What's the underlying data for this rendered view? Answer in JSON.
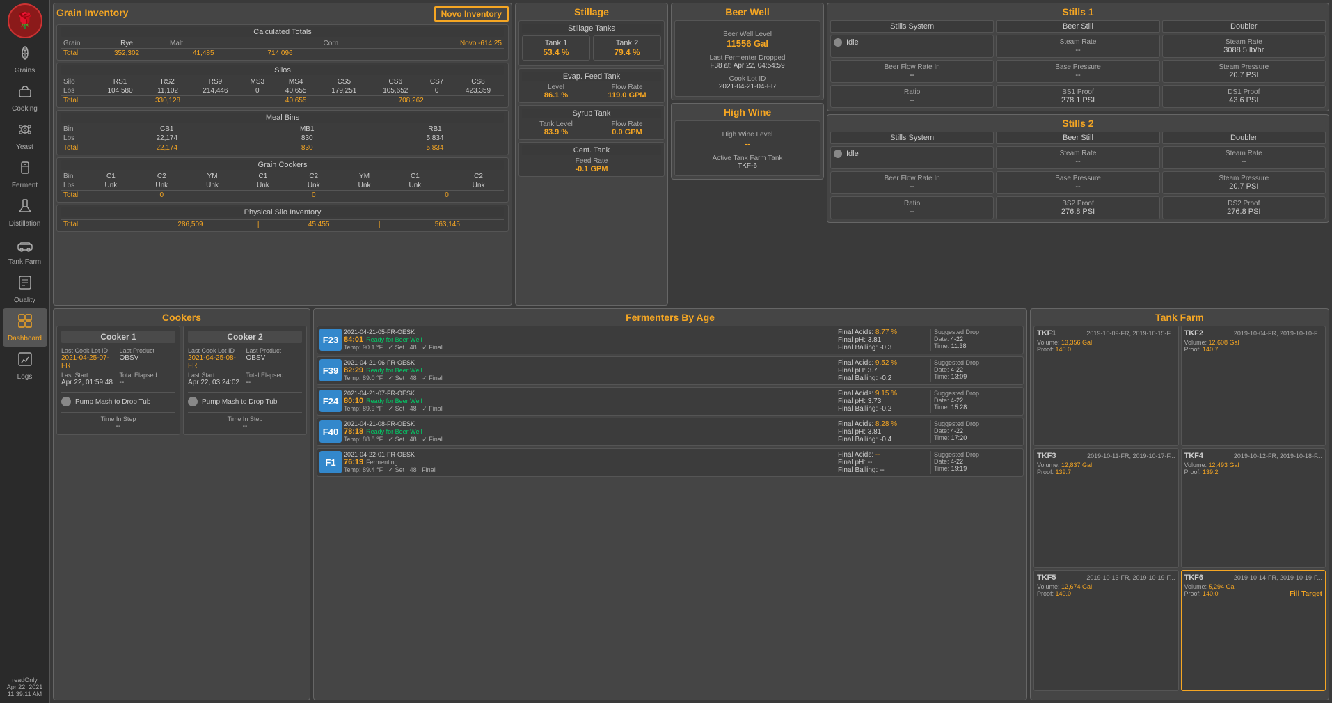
{
  "sidebar": {
    "logo_symbol": "🌹",
    "items": [
      {
        "label": "Grains",
        "icon": "🌾",
        "active": false
      },
      {
        "label": "Cooking",
        "icon": "🍲",
        "active": false
      },
      {
        "label": "Yeast",
        "icon": "⚙️",
        "active": false
      },
      {
        "label": "Ferment",
        "icon": "🧪",
        "active": false
      },
      {
        "label": "Distillation",
        "icon": "🧴",
        "active": false
      },
      {
        "label": "Tank Farm",
        "icon": "🚚",
        "active": false
      },
      {
        "label": "Quality",
        "icon": "📋",
        "active": false
      },
      {
        "label": "Dashboard",
        "icon": "📊",
        "active": true
      },
      {
        "label": "Logs",
        "icon": "📈",
        "active": false
      }
    ],
    "status": {
      "user": "readOnly",
      "date": "Apr 22, 2021",
      "time": "11:39:11 AM"
    }
  },
  "grain_inventory": {
    "title": "Grain Inventory",
    "novo_btn": "Novo Inventory",
    "novo_value": "-614.25",
    "calculated_totals": {
      "title": "Calculated Totals",
      "cols": [
        "Grain",
        "Novo",
        "-614.25"
      ],
      "row1_labels": [
        "Grain",
        "Malt",
        "Corn"
      ],
      "row1_vals": [
        "Rye",
        "",
        ""
      ],
      "total_label": "Total",
      "totals": [
        "352,302",
        "41,485",
        "714,096"
      ]
    },
    "silos": {
      "title": "Silos",
      "headers": [
        "Silo",
        "RS1",
        "RS2",
        "RS9",
        "MS3",
        "MS4",
        "CS5",
        "CS6",
        "CS7",
        "CS8"
      ],
      "lbs_row": [
        "Lbs",
        "104,580",
        "11,102",
        "214,446",
        "0",
        "40,655",
        "179,251",
        "105,652",
        "0",
        "423,359"
      ],
      "total_row": [
        "Total",
        "330,128",
        "",
        "",
        "",
        "40,655",
        "",
        "",
        "",
        "708,262"
      ]
    },
    "meal_bins": {
      "title": "Meal Bins",
      "headers": [
        "Bin",
        "CB1",
        "",
        "MB1",
        "",
        "RB1"
      ],
      "lbs_row": [
        "Lbs",
        "22,174",
        "",
        "830",
        "",
        "5,834"
      ],
      "total_row": [
        "Total",
        "22,174",
        "",
        "830",
        "",
        "5,834"
      ]
    },
    "grain_cookers": {
      "title": "Grain Cookers",
      "headers": [
        "Bin",
        "C1",
        "C2",
        "YM",
        "C1",
        "C2",
        "YM",
        "C1",
        "",
        "C2"
      ],
      "lbs_row": [
        "Lbs",
        "Unk",
        "Unk",
        "Unk",
        "Unk",
        "Unk",
        "Unk",
        "Unk",
        "",
        "Unk"
      ],
      "total_row": [
        "Total",
        "0",
        "",
        "",
        "0",
        "",
        "",
        "0"
      ]
    },
    "physical_silo": {
      "title": "Physical Silo Inventory",
      "total_label": "Total",
      "totals": [
        "286,509",
        "45,455",
        "563,145"
      ]
    }
  },
  "stillage": {
    "title": "Stillage",
    "stillage_tanks": {
      "title": "Stillage Tanks",
      "tank1_label": "Tank 1",
      "tank1_val": "53.4 %",
      "tank2_label": "Tank 2",
      "tank2_val": "79.4 %"
    },
    "evap_feed": {
      "title": "Evap. Feed Tank",
      "level_label": "Level",
      "level_val": "86.1 %",
      "flow_label": "Flow Rate",
      "flow_val": "119.0 GPM"
    },
    "syrup_tank": {
      "title": "Syrup Tank",
      "level_label": "Tank Level",
      "level_val": "83.9 %",
      "flow_label": "Flow Rate",
      "flow_val": "0.0 GPM"
    },
    "cent_tank": {
      "title": "Cent. Tank",
      "feed_label": "Feed Rate",
      "feed_val": "-0.1 GPM"
    }
  },
  "beer_well": {
    "title": "Beer Well",
    "level_label": "Beer Well Level",
    "level_val": "11556 Gal",
    "dropped_label": "Last Fermenter Dropped",
    "dropped_val": "F38 at: Apr 22, 04:54:59",
    "cook_label": "Cook Lot ID",
    "cook_val": "2021-04-21-04-FR"
  },
  "high_wine": {
    "title": "High Wine",
    "level_label": "High Wine Level",
    "level_val": "--",
    "active_label": "Active Tank Farm Tank",
    "active_val": "TKF-6"
  },
  "stills1": {
    "title": "Stills 1",
    "stills_system_label": "Stills System",
    "beer_still_label": "Beer Still",
    "doubler_label": "Doubler",
    "idle_label": "Idle",
    "steam_rate_label": "Steam Rate",
    "steam_rate_val": "--",
    "steam_rate_d_label": "Steam Rate",
    "steam_rate_d_val": "3088.5 lb/hr",
    "beer_flow_label": "Beer Flow Rate In",
    "beer_flow_val": "--",
    "base_pressure_label": "Base Pressure",
    "base_pressure_val": "--",
    "steam_pressure_label": "Steam Pressure",
    "steam_pressure_val": "20.7 PSI",
    "ratio_label": "Ratio",
    "ratio_val": "--",
    "bs1_proof_label": "BS1 Proof",
    "bs1_proof_val": "278.1 PSI",
    "ds1_proof_label": "DS1 Proof",
    "ds1_proof_val": "43.6 PSI"
  },
  "stills2": {
    "title": "Stills 2",
    "stills_system_label": "Stills System",
    "beer_still_label": "Beer Still",
    "doubler_label": "Doubler",
    "idle_label": "Idle",
    "steam_rate_label": "Steam Rate",
    "steam_rate_val": "--",
    "steam_rate_d_label": "Steam Rate",
    "steam_rate_d_val": "--",
    "beer_flow_label": "Beer Flow Rate In",
    "beer_flow_val": "--",
    "base_pressure_label": "Base Pressure",
    "base_pressure_val": "--",
    "steam_pressure_label": "Steam Pressure",
    "steam_pressure_val": "20.7 PSI",
    "ratio_label": "Ratio",
    "ratio_val": "--",
    "bs2_proof_label": "BS2 Proof",
    "bs2_proof_val": "276.8 PSI",
    "ds2_proof_label": "DS2 Proof",
    "ds2_proof_val": "276.8 PSI"
  },
  "cookers": {
    "title": "Cookers",
    "cooker1": {
      "title": "Cooker 1",
      "last_cook_label": "Last Cook Lot ID",
      "last_cook_val": "2021-04-25-07-FR",
      "last_product_label": "Last Product",
      "last_product_val": "OBSV",
      "last_start_label": "Last Start",
      "last_start_val": "Apr 22, 01:59:48",
      "total_elapsed_label": "Total Elapsed",
      "total_elapsed_val": "--",
      "pump_label": "Pump Mash to Drop Tub",
      "time_step_label": "Time In Step",
      "time_step_val": "--"
    },
    "cooker2": {
      "title": "Cooker 2",
      "last_cook_label": "Last Cook Lot ID",
      "last_cook_val": "2021-04-25-08-FR",
      "last_product_label": "Last Product",
      "last_product_val": "OBSV",
      "last_start_label": "Last Start",
      "last_start_val": "Apr 22, 03:24:02",
      "total_elapsed_label": "Total Elapsed",
      "total_elapsed_val": "--",
      "pump_label": "Pump Mash to Drop Tub",
      "time_step_label": "Time In Step",
      "time_step_val": "--"
    }
  },
  "fermenters": {
    "title": "Fermenters By Age",
    "items": [
      {
        "id": "F23",
        "date": "2021-04-21-05-FR-OESK",
        "age": "84:01",
        "status": "Ready for Beer Well",
        "temp": "Temp: 90.1 °F",
        "set": "✓ Set",
        "setval": "48",
        "final": "✓ Final",
        "acids": "Final Acids: 8.77 %",
        "ph": "Final pH: 3.81",
        "balling": "Final Balling: -0.3",
        "drop_date": "4-22",
        "drop_time": "11:38"
      },
      {
        "id": "F39",
        "date": "2021-04-21-06-FR-OESK",
        "age": "82:29",
        "status": "Ready for Beer Well",
        "temp": "Temp: 89.0 °F",
        "set": "✓ Set",
        "setval": "48",
        "final": "✓ Final",
        "acids": "Final Acids: 9.52 %",
        "ph": "Final pH: 3.7",
        "balling": "Final Balling: -0.2",
        "drop_date": "4-22",
        "drop_time": "13:09"
      },
      {
        "id": "F24",
        "date": "2021-04-21-07-FR-OESK",
        "age": "80:10",
        "status": "Ready for Beer Well",
        "temp": "Temp: 89.9 °F",
        "set": "✓ Set",
        "setval": "48",
        "final": "✓ Final",
        "acids": "Final Acids: 9.15 %",
        "ph": "Final pH: 3.73",
        "balling": "Final Balling: -0.2",
        "drop_date": "4-22",
        "drop_time": "15:28"
      },
      {
        "id": "F40",
        "date": "2021-04-21-08-FR-OESK",
        "age": "78:18",
        "status": "Ready for Beer Well",
        "temp": "Temp: 88.8 °F",
        "set": "✓ Set",
        "setval": "48",
        "final": "✓ Final",
        "acids": "Final Acids: 8.28 %",
        "ph": "Final pH: 3.81",
        "balling": "Final Balling: -0.4",
        "drop_date": "4-22",
        "drop_time": "17:20"
      },
      {
        "id": "F1",
        "date": "2021-04-22-01-FR-OESK",
        "age": "76:19",
        "status": "Fermenting",
        "temp": "Temp: 89.4 °F",
        "set": "✓ Set",
        "setval": "48",
        "final": "Final",
        "acids": "Final Acids: --",
        "ph": "Final pH: --",
        "balling": "Final Balling: --",
        "drop_date": "4-22",
        "drop_time": "19:19"
      }
    ]
  },
  "tank_farm": {
    "title": "Tank Farm",
    "tanks": [
      {
        "id": "TKF1",
        "dates": "2019-10-09-FR, 2019-10-15-F...",
        "volume": "13,356 Gal",
        "proof": "140.0",
        "fill_target": false
      },
      {
        "id": "TKF2",
        "dates": "2019-10-04-FR, 2019-10-10-F...",
        "volume": "12,608 Gal",
        "proof": "140.7",
        "fill_target": false
      },
      {
        "id": "TKF3",
        "dates": "2019-10-11-FR, 2019-10-17-F...",
        "volume": "12,837 Gal",
        "proof": "139.7",
        "fill_target": false
      },
      {
        "id": "TKF4",
        "dates": "2019-10-12-FR, 2019-10-18-F...",
        "volume": "12,493 Gal",
        "proof": "139.2",
        "fill_target": false
      },
      {
        "id": "TKF5",
        "dates": "2019-10-13-FR, 2019-10-19-F...",
        "volume": "12,674 Gal",
        "proof": "140.0",
        "fill_target": false
      },
      {
        "id": "TKF6",
        "dates": "2019-10-14-FR, 2019-10-19-F...",
        "volume": "5,294 Gal",
        "proof": "140.0",
        "fill_target": true,
        "fill_label": "Fill Target"
      }
    ]
  }
}
